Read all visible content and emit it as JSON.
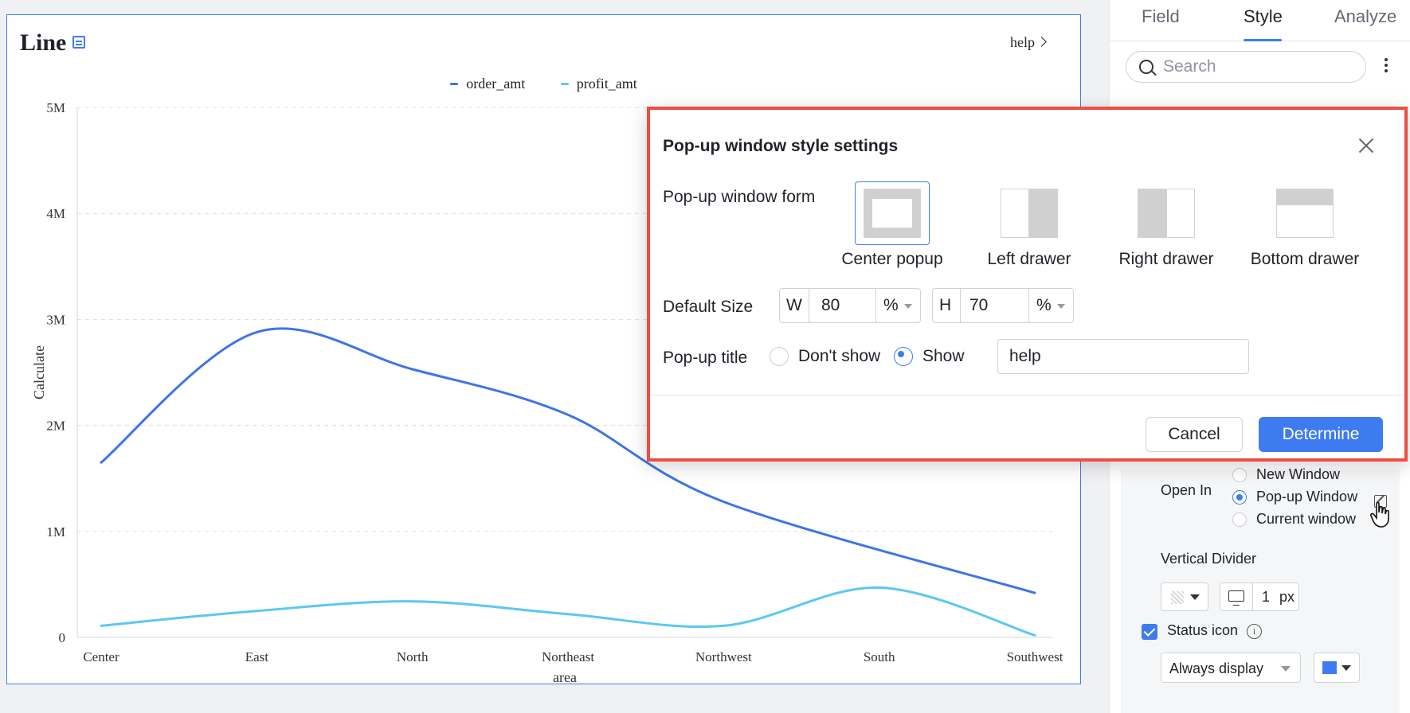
{
  "chart_card": {
    "title": "Line",
    "help_link": "help",
    "legend": [
      {
        "name": "order_amt",
        "color": "#3e74e8"
      },
      {
        "name": "profit_amt",
        "color": "#5cc7f2"
      }
    ]
  },
  "chart_data": {
    "type": "line",
    "title": "Line",
    "xlabel": "area",
    "ylabel": "Calculate",
    "categories": [
      "Center",
      "East",
      "North",
      "Northeast",
      "Northwest",
      "South",
      "Southwest"
    ],
    "ylim": [
      0,
      5000000
    ],
    "yticks": [
      "0",
      "1M",
      "2M",
      "3M",
      "4M",
      "5M"
    ],
    "grid": true,
    "legend_position": "top-center",
    "series": [
      {
        "name": "order_amt",
        "color": "#3e74e8",
        "values": [
          1650000,
          2880000,
          2530000,
          2100000,
          1280000,
          null,
          420000
        ]
      },
      {
        "name": "profit_amt",
        "color": "#5cc7f2",
        "values": [
          110000,
          250000,
          340000,
          220000,
          110000,
          470000,
          20000
        ]
      }
    ]
  },
  "panel": {
    "tabs": [
      {
        "label": "Field"
      },
      {
        "label": "Style"
      },
      {
        "label": "Analyze"
      }
    ],
    "search_placeholder": "Search",
    "open_in": {
      "label": "Open In",
      "options": [
        "New Window",
        "Pop-up Window",
        "Current window"
      ],
      "selected": "Pop-up Window"
    },
    "vertical_divider": {
      "label": "Vertical Divider",
      "width_value": "1",
      "unit": "px"
    },
    "status_icon": {
      "label": "Status icon",
      "checked": true,
      "display": "Always display",
      "color": "#3e7bf0"
    }
  },
  "dialog": {
    "title": "Pop-up window style settings",
    "form_label": "Pop-up window form",
    "forms": [
      "Center popup",
      "Left drawer",
      "Right drawer",
      "Bottom drawer"
    ],
    "selected_form": "Center popup",
    "size_label": "Default Size",
    "width": {
      "prefix": "W",
      "value": "80",
      "unit": "%"
    },
    "height": {
      "prefix": "H",
      "value": "70",
      "unit": "%"
    },
    "popup_title_label": "Pop-up title",
    "title_options": [
      "Don't show",
      "Show"
    ],
    "title_selected": "Show",
    "title_value": "help",
    "cancel_label": "Cancel",
    "ok_label": "Determine"
  }
}
